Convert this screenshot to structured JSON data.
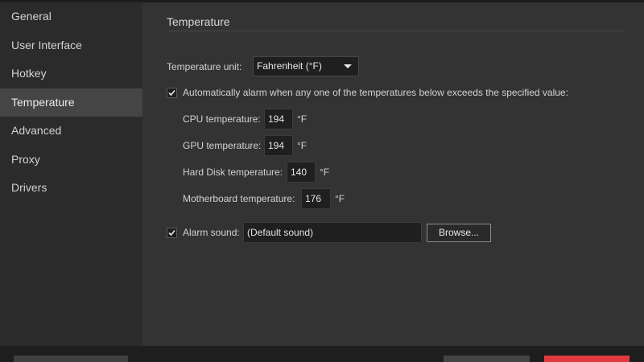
{
  "sidebar": {
    "items": [
      {
        "label": "General"
      },
      {
        "label": "User Interface"
      },
      {
        "label": "Hotkey"
      },
      {
        "label": "Temperature"
      },
      {
        "label": "Advanced"
      },
      {
        "label": "Proxy"
      },
      {
        "label": "Drivers"
      }
    ],
    "active_index": 3
  },
  "main": {
    "section_title": "Temperature",
    "temperature_unit": {
      "label": "Temperature unit:",
      "value": "Fahrenheit (°F)",
      "icon": "caret-down-icon"
    },
    "auto_alarm": {
      "checked": true,
      "label": "Automatically alarm when any one of the temperatures below exceeds the specified value:"
    },
    "thresholds": [
      {
        "label": "CPU temperature:",
        "value": "194",
        "unit": "°F"
      },
      {
        "label": "GPU temperature:",
        "value": "194",
        "unit": "°F"
      },
      {
        "label": "Hard Disk temperature:",
        "value": "140",
        "unit": "°F"
      },
      {
        "label": "Motherboard temperature:",
        "value": "176",
        "unit": "°F"
      }
    ],
    "alarm_sound": {
      "checked": true,
      "label": "Alarm sound:",
      "value": "(Default sound)",
      "browse_label": "Browse..."
    }
  },
  "colors": {
    "background": "#333333",
    "sidebar": "#2b2b2b",
    "active_item": "#454545",
    "input": "#1f1f1f",
    "accent_red": "#e03a3e"
  }
}
